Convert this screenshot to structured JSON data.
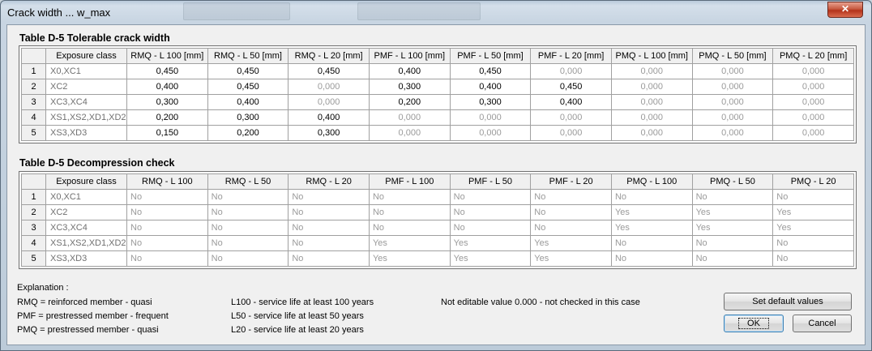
{
  "window": {
    "title": "Crack width ... w_max"
  },
  "table1": {
    "title": "Table D-5  Tolerable crack width",
    "columns": [
      "Exposure class",
      "RMQ - L 100 [mm]",
      "RMQ - L 50 [mm]",
      "RMQ - L 20 [mm]",
      "PMF - L 100 [mm]",
      "PMF - L 50 [mm]",
      "PMF - L 20 [mm]",
      "PMQ - L 100 [mm]",
      "PMQ - L 50 [mm]",
      "PMQ - L 20 [mm]"
    ],
    "rows": [
      {
        "n": "1",
        "cls": "X0,XC1",
        "v": [
          "0,450",
          "0,450",
          "0,450",
          "0,400",
          "0,450",
          "0,000",
          "0,000",
          "0,000",
          "0,000"
        ],
        "ed": [
          1,
          1,
          1,
          1,
          1,
          0,
          0,
          0,
          0
        ]
      },
      {
        "n": "2",
        "cls": "XC2",
        "v": [
          "0,400",
          "0,450",
          "0,000",
          "0,300",
          "0,400",
          "0,450",
          "0,000",
          "0,000",
          "0,000"
        ],
        "ed": [
          1,
          1,
          0,
          1,
          1,
          1,
          0,
          0,
          0
        ]
      },
      {
        "n": "3",
        "cls": "XC3,XC4",
        "v": [
          "0,300",
          "0,400",
          "0,000",
          "0,200",
          "0,300",
          "0,400",
          "0,000",
          "0,000",
          "0,000"
        ],
        "ed": [
          1,
          1,
          0,
          1,
          1,
          1,
          0,
          0,
          0
        ]
      },
      {
        "n": "4",
        "cls": "XS1,XS2,XD1,XD2",
        "v": [
          "0,200",
          "0,300",
          "0,400",
          "0,000",
          "0,000",
          "0,000",
          "0,000",
          "0,000",
          "0,000"
        ],
        "ed": [
          1,
          1,
          1,
          0,
          0,
          0,
          0,
          0,
          0
        ]
      },
      {
        "n": "5",
        "cls": "XS3,XD3",
        "v": [
          "0,150",
          "0,200",
          "0,300",
          "0,000",
          "0,000",
          "0,000",
          "0,000",
          "0,000",
          "0,000"
        ],
        "ed": [
          1,
          1,
          1,
          0,
          0,
          0,
          0,
          0,
          0
        ]
      }
    ]
  },
  "table2": {
    "title": "Table D-5  Decompression check",
    "columns": [
      "Exposure class",
      "RMQ - L 100",
      "RMQ - L 50",
      "RMQ - L 20",
      "PMF - L 100",
      "PMF - L 50",
      "PMF - L 20",
      "PMQ - L 100",
      "PMQ - L 50",
      "PMQ - L 20"
    ],
    "rows": [
      {
        "n": "1",
        "cls": "X0,XC1",
        "v": [
          "No",
          "No",
          "No",
          "No",
          "No",
          "No",
          "No",
          "No",
          "No"
        ]
      },
      {
        "n": "2",
        "cls": "XC2",
        "v": [
          "No",
          "No",
          "No",
          "No",
          "No",
          "No",
          "Yes",
          "Yes",
          "Yes"
        ]
      },
      {
        "n": "3",
        "cls": "XC3,XC4",
        "v": [
          "No",
          "No",
          "No",
          "No",
          "No",
          "No",
          "Yes",
          "Yes",
          "Yes"
        ]
      },
      {
        "n": "4",
        "cls": "XS1,XS2,XD1,XD2",
        "v": [
          "No",
          "No",
          "No",
          "Yes",
          "Yes",
          "Yes",
          "No",
          "No",
          "No"
        ]
      },
      {
        "n": "5",
        "cls": "XS3,XD3",
        "v": [
          "No",
          "No",
          "No",
          "Yes",
          "Yes",
          "Yes",
          "No",
          "No",
          "No"
        ]
      }
    ]
  },
  "explanation": {
    "heading": "Explanation :",
    "rmq": "RMQ = reinforced member - quasi",
    "pmf": "PMF = prestressed member - frequent",
    "pmq": "PMQ = prestressed member - quasi",
    "l100": "L100 - service life at least 100 years",
    "l50": "L50 - service life at least 50 years",
    "l20": "L20 - service life at least 20 years",
    "note": "Not editable value 0.000 - not checked in this case"
  },
  "buttons": {
    "set_default": "Set default values",
    "ok": "OK",
    "cancel": "Cancel"
  },
  "colors": {
    "editable_text": "#000000",
    "readonly_text": "#9a9a9a",
    "close_button": "#c75a40"
  },
  "icons": {
    "close": "close-icon"
  }
}
